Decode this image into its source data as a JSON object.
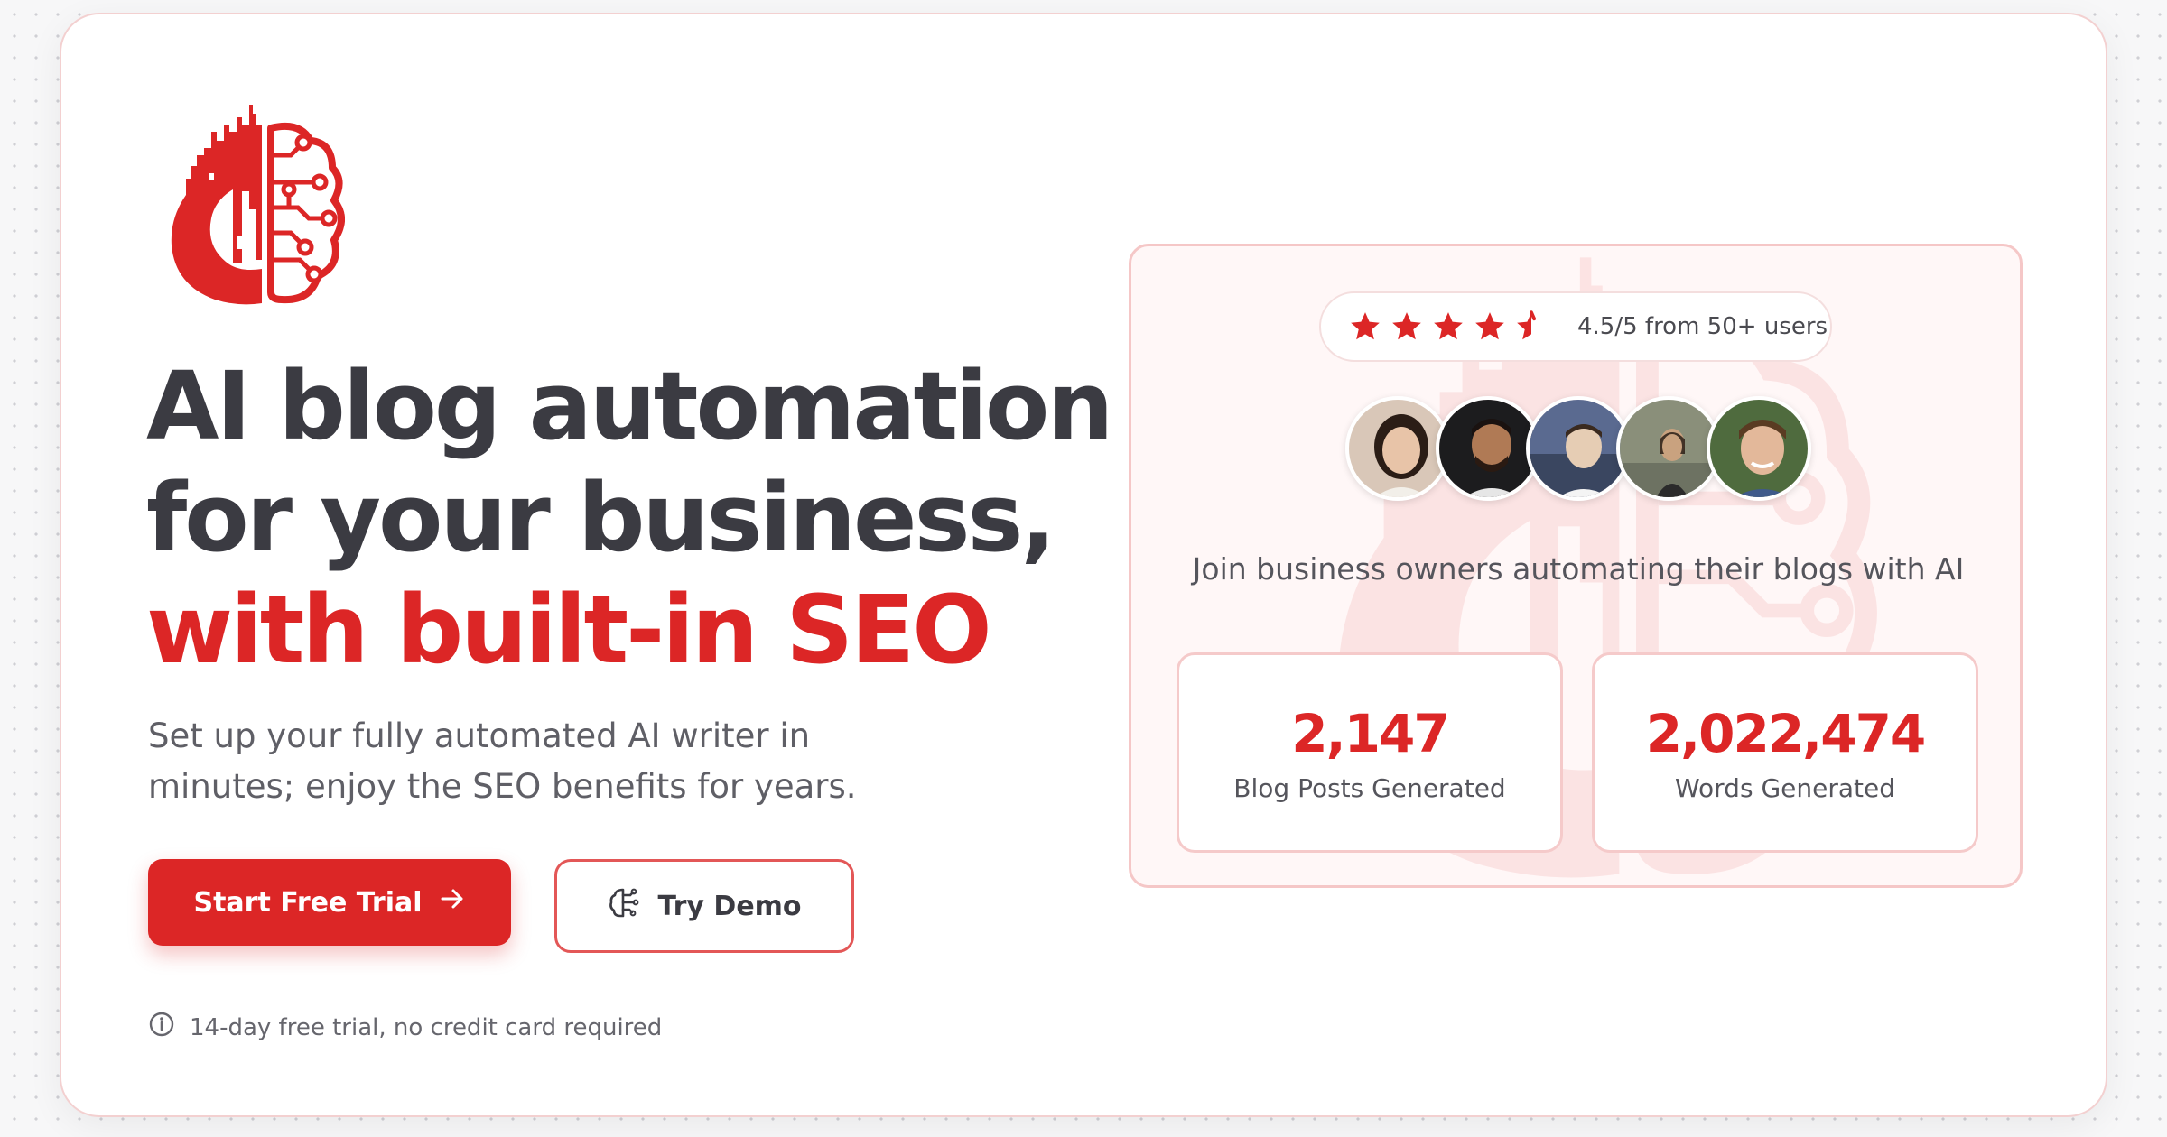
{
  "brand": {
    "logo_icon": "brain-city-icon",
    "accent_color": "#dc2626"
  },
  "hero": {
    "headline_line1": "AI blog automation",
    "headline_line2": "for your business,",
    "headline_line3": "with built-in SEO",
    "subtext": "Set up your fully automated AI writer in minutes; enjoy the SEO benefits for years.",
    "primary_cta": "Start Free Trial",
    "primary_cta_icon": "arrow-right-icon",
    "secondary_cta": "Try Demo",
    "secondary_cta_icon": "brain-icon",
    "trial_note": "14-day free trial, no credit card required",
    "trial_note_icon": "info-icon"
  },
  "social_proof": {
    "rating_stars": 4.5,
    "rating_text": "4.5/5 from 50+ users",
    "avatars": [
      {
        "name": "user-avatar-1",
        "bg": "#d9c7b8",
        "skin": "#e8c4a8",
        "hair": "#2b1d16"
      },
      {
        "name": "user-avatar-2",
        "bg": "#1c1c1e",
        "skin": "#b07a55",
        "hair": "#1a1210"
      },
      {
        "name": "user-avatar-3",
        "bg": "#4a5a7a",
        "skin": "#e6cdb4",
        "hair": "#3a2a1f"
      },
      {
        "name": "user-avatar-4",
        "bg": "#8a8f7a",
        "skin": "#c9a27f",
        "hair": "#2a1e16"
      },
      {
        "name": "user-avatar-5",
        "bg": "#4f6b3e",
        "skin": "#e3b89a",
        "hair": "#5a3b22"
      }
    ],
    "join_text": "Join business owners automating their blogs with AI",
    "stats": [
      {
        "value": "2,147",
        "label": "Blog Posts Generated"
      },
      {
        "value": "2,022,474",
        "label": "Words Generated"
      }
    ]
  }
}
